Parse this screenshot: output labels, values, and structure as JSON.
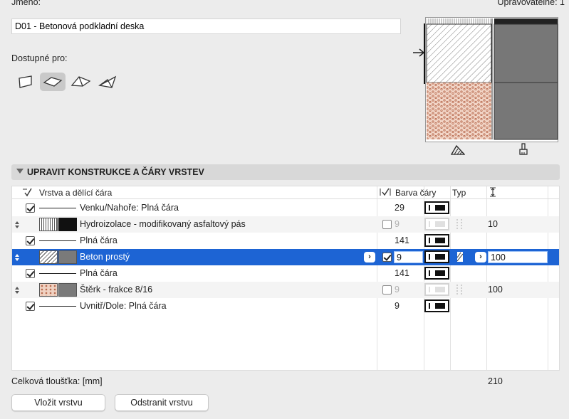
{
  "header": {
    "name_label": "Jméno:",
    "editable_label": "Upravovatelné: 1"
  },
  "name_field": {
    "value": "D01 - Betonová podkladní deska"
  },
  "available_for": {
    "label": "Dostupné pro:",
    "icons": [
      "wall-icon",
      "slab-icon",
      "roof-icon",
      "shell-icon"
    ],
    "active": "slab-icon"
  },
  "preview": {
    "bottom_icons": [
      "hatch-pen-icon",
      "paint-brush-icon"
    ]
  },
  "section": {
    "title": "UPRAVIT KONSTRUKCE A ČÁRY VRSTEV"
  },
  "table": {
    "headers": {
      "layer": "Vrstva a dělící čára",
      "pen_color": "Barva čáry",
      "type": "Typ"
    },
    "rows": [
      {
        "kind": "line",
        "checked": true,
        "label": "Venku/Nahoře: Plná čára",
        "pen": "29"
      },
      {
        "kind": "layer",
        "label": "Hydroizolace - modifikovaný asfaltový pás",
        "pen": "9",
        "pen_disabled": true,
        "thickness": "10",
        "fill": "membrane"
      },
      {
        "kind": "line",
        "checked": true,
        "label": "Plná čára",
        "pen": "141"
      },
      {
        "kind": "layer",
        "label": "Beton prostý",
        "pen": "9",
        "pen_checked": true,
        "thickness": "100",
        "fill": "concrete",
        "selected": true
      },
      {
        "kind": "line",
        "checked": true,
        "label": "Plná čára",
        "pen": "141"
      },
      {
        "kind": "layer",
        "label": "Štěrk - frakce 8/16",
        "pen": "9",
        "pen_disabled": true,
        "thickness": "100",
        "fill": "gravel"
      },
      {
        "kind": "line",
        "checked": true,
        "label": "Uvnitř/Dole: Plná čára",
        "pen": "9"
      }
    ]
  },
  "footer": {
    "total_label": "Celková tloušťka: [mm]",
    "total_value": "210",
    "insert_button": "Vložit vrstvu",
    "remove_button": "Odstranit vrstvu"
  },
  "colors": {
    "selection": "#1d64d4",
    "background": "#ececec",
    "gravel": "#c98a6b",
    "slab_fill": "#777777"
  }
}
